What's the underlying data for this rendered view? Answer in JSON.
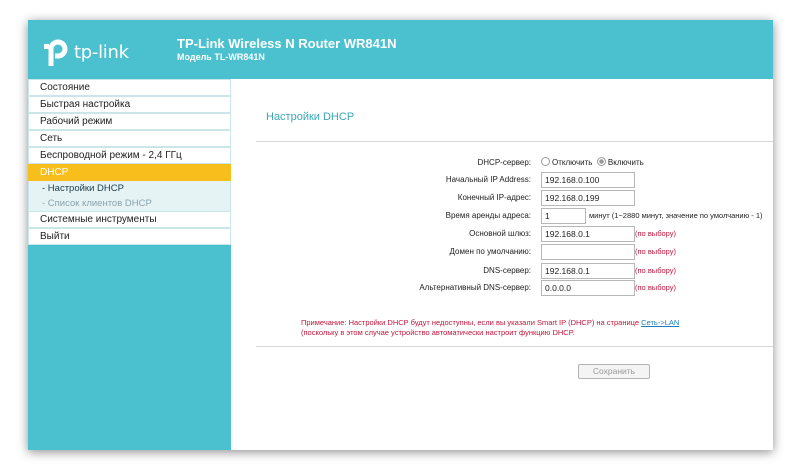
{
  "header": {
    "logo_text": "tp-link",
    "title": "TP-Link Wireless N Router WR841N",
    "model": "Модель TL-WR841N"
  },
  "sidebar": {
    "items": [
      {
        "label": "Состояние"
      },
      {
        "label": "Быстрая настройка"
      },
      {
        "label": "Рабочий режим"
      },
      {
        "label": "Сеть"
      },
      {
        "label": "Беспроводной режим - 2,4 ГГц"
      },
      {
        "label": "DHCP"
      },
      {
        "label": "Системные инструменты"
      },
      {
        "label": "Выйти"
      }
    ],
    "subitems": [
      {
        "label": "- Настройки DHCP"
      },
      {
        "label": "- Список клиентов DHCP"
      }
    ]
  },
  "colors": {
    "accent": "#4bc1cf",
    "active": "#f8be1c",
    "note": "#c0163c"
  },
  "main": {
    "page_title": "Настройки DHCP",
    "dhcp_server": {
      "label": "DHCP-сервер:",
      "off": "Отключить",
      "on": "Включить",
      "selected": "Включить"
    },
    "fields": {
      "start_ip": {
        "label": "Начальный IP Address:",
        "value": "192.168.0.100"
      },
      "end_ip": {
        "label": "Конечный IP-адрес:",
        "value": "192.168.0.199"
      },
      "lease": {
        "label": "Время аренды адреса:",
        "value": "1",
        "note": "минут (1~2880 минут, значение по умолчанию - 1)"
      },
      "gateway": {
        "label": "Основной шлюз:",
        "value": "192.168.0.1",
        "note": "(по выбору)"
      },
      "domain": {
        "label": "Домен по умолчанию:",
        "value": "",
        "note": "(по выбору)"
      },
      "dns": {
        "label": "DNS-сервер:",
        "value": "192.168.0.1",
        "note": "(по выбору)"
      },
      "alt_dns": {
        "label": "Альтернативный DNS-сервер:",
        "value": "0.0.0.0",
        "note": "(по выбору)"
      }
    },
    "note_text": "Примечание: Настройки DHCP будут недоступны, если вы указали Smart IP (DHCP) на странице ",
    "note_link": "Сеть->LAN",
    "note_text2": "(поскольку в этом случае устройство автоматически настроит функцию DHCP.",
    "save_label": "Сохранить"
  }
}
